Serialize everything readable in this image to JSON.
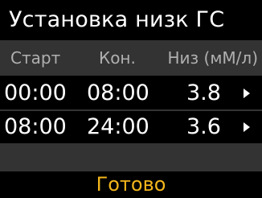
{
  "screen": {
    "title": "Установка низк ГС"
  },
  "table": {
    "headers": {
      "start": "Старт",
      "end": "Кон.",
      "low": "Низ (мМ/л)"
    },
    "rows": [
      {
        "start": "00:00",
        "end": "08:00",
        "low": "3.8",
        "arrow_icon": "chevron-right-icon"
      },
      {
        "start": "08:00",
        "end": "24:00",
        "low": "3.6",
        "arrow_icon": "chevron-right-icon"
      }
    ]
  },
  "footer": {
    "done_label": "Готово"
  },
  "colors": {
    "background": "#000000",
    "header_bg": "#333333",
    "accent": "#f2b51b",
    "text": "#ffffff",
    "muted_text": "#b0b0b0"
  }
}
